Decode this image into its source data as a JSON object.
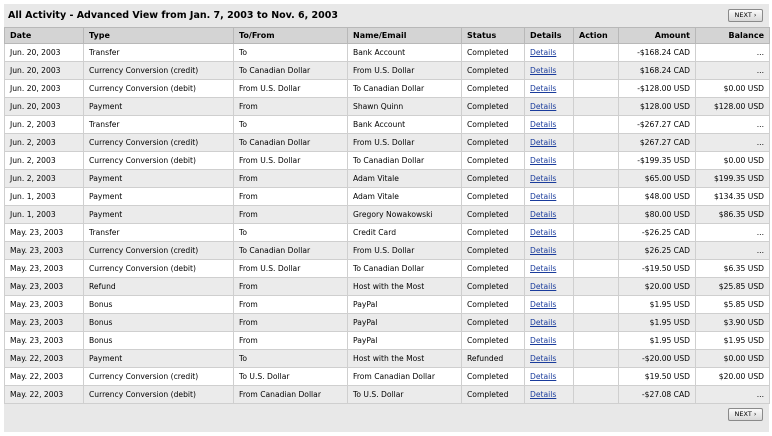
{
  "header": {
    "title": "All Activity - Advanced View from Jan. 7, 2003 to Nov. 6, 2003",
    "next_label": "NEXT ›"
  },
  "columns": [
    "Date",
    "Type",
    "To/From",
    "Name/Email",
    "Status",
    "Details",
    "Action",
    "Amount",
    "Balance"
  ],
  "rows": [
    {
      "date": "Jun. 20, 2003",
      "type": "Transfer",
      "tofrom": "To",
      "name": "Bank Account",
      "status": "Completed",
      "details": "Details",
      "action": "",
      "amount": "-$168.24 CAD",
      "balance": "..."
    },
    {
      "date": "Jun. 20, 2003",
      "type": "Currency Conversion (credit)",
      "tofrom": "To Canadian Dollar",
      "name": "From U.S. Dollar",
      "status": "Completed",
      "details": "Details",
      "action": "",
      "amount": "$168.24 CAD",
      "balance": "..."
    },
    {
      "date": "Jun. 20, 2003",
      "type": "Currency Conversion (debit)",
      "tofrom": "From U.S. Dollar",
      "name": "To Canadian Dollar",
      "status": "Completed",
      "details": "Details",
      "action": "",
      "amount": "-$128.00 USD",
      "balance": "$0.00 USD"
    },
    {
      "date": "Jun. 20, 2003",
      "type": "Payment",
      "tofrom": "From",
      "name": "Shawn Quinn",
      "status": "Completed",
      "details": "Details",
      "action": "",
      "amount": "$128.00 USD",
      "balance": "$128.00 USD"
    },
    {
      "date": "Jun. 2, 2003",
      "type": "Transfer",
      "tofrom": "To",
      "name": "Bank Account",
      "status": "Completed",
      "details": "Details",
      "action": "",
      "amount": "-$267.27 CAD",
      "balance": "..."
    },
    {
      "date": "Jun. 2, 2003",
      "type": "Currency Conversion (credit)",
      "tofrom": "To Canadian Dollar",
      "name": "From U.S. Dollar",
      "status": "Completed",
      "details": "Details",
      "action": "",
      "amount": "$267.27 CAD",
      "balance": "..."
    },
    {
      "date": "Jun. 2, 2003",
      "type": "Currency Conversion (debit)",
      "tofrom": "From U.S. Dollar",
      "name": "To Canadian Dollar",
      "status": "Completed",
      "details": "Details",
      "action": "",
      "amount": "-$199.35 USD",
      "balance": "$0.00 USD"
    },
    {
      "date": "Jun. 2, 2003",
      "type": "Payment",
      "tofrom": "From",
      "name": "Adam Vitale",
      "status": "Completed",
      "details": "Details",
      "action": "",
      "amount": "$65.00 USD",
      "balance": "$199.35 USD"
    },
    {
      "date": "Jun. 1, 2003",
      "type": "Payment",
      "tofrom": "From",
      "name": "Adam Vitale",
      "status": "Completed",
      "details": "Details",
      "action": "",
      "amount": "$48.00 USD",
      "balance": "$134.35 USD"
    },
    {
      "date": "Jun. 1, 2003",
      "type": "Payment",
      "tofrom": "From",
      "name": "Gregory Nowakowski",
      "status": "Completed",
      "details": "Details",
      "action": "",
      "amount": "$80.00 USD",
      "balance": "$86.35 USD"
    },
    {
      "date": "May. 23, 2003",
      "type": "Transfer",
      "tofrom": "To",
      "name": "Credit Card",
      "status": "Completed",
      "details": "Details",
      "action": "",
      "amount": "-$26.25 CAD",
      "balance": "..."
    },
    {
      "date": "May. 23, 2003",
      "type": "Currency Conversion (credit)",
      "tofrom": "To Canadian Dollar",
      "name": "From U.S. Dollar",
      "status": "Completed",
      "details": "Details",
      "action": "",
      "amount": "$26.25 CAD",
      "balance": "..."
    },
    {
      "date": "May. 23, 2003",
      "type": "Currency Conversion (debit)",
      "tofrom": "From U.S. Dollar",
      "name": "To Canadian Dollar",
      "status": "Completed",
      "details": "Details",
      "action": "",
      "amount": "-$19.50 USD",
      "balance": "$6.35 USD"
    },
    {
      "date": "May. 23, 2003",
      "type": "Refund",
      "tofrom": "From",
      "name": "Host with the Most",
      "status": "Completed",
      "details": "Details",
      "action": "",
      "amount": "$20.00 USD",
      "balance": "$25.85 USD"
    },
    {
      "date": "May. 23, 2003",
      "type": "Bonus",
      "tofrom": "From",
      "name": "PayPal",
      "status": "Completed",
      "details": "Details",
      "action": "",
      "amount": "$1.95 USD",
      "balance": "$5.85 USD"
    },
    {
      "date": "May. 23, 2003",
      "type": "Bonus",
      "tofrom": "From",
      "name": "PayPal",
      "status": "Completed",
      "details": "Details",
      "action": "",
      "amount": "$1.95 USD",
      "balance": "$3.90 USD"
    },
    {
      "date": "May. 23, 2003",
      "type": "Bonus",
      "tofrom": "From",
      "name": "PayPal",
      "status": "Completed",
      "details": "Details",
      "action": "",
      "amount": "$1.95 USD",
      "balance": "$1.95 USD"
    },
    {
      "date": "May. 22, 2003",
      "type": "Payment",
      "tofrom": "To",
      "name": "Host with the Most",
      "status": "Refunded",
      "details": "Details",
      "action": "",
      "amount": "-$20.00 USD",
      "balance": "$0.00 USD"
    },
    {
      "date": "May. 22, 2003",
      "type": "Currency Conversion (credit)",
      "tofrom": "To U.S. Dollar",
      "name": "From Canadian Dollar",
      "status": "Completed",
      "details": "Details",
      "action": "",
      "amount": "$19.50 USD",
      "balance": "$20.00 USD"
    },
    {
      "date": "May. 22, 2003",
      "type": "Currency Conversion (debit)",
      "tofrom": "From Canadian Dollar",
      "name": "To U.S. Dollar",
      "status": "Completed",
      "details": "Details",
      "action": "",
      "amount": "-$27.08 CAD",
      "balance": "..."
    }
  ]
}
